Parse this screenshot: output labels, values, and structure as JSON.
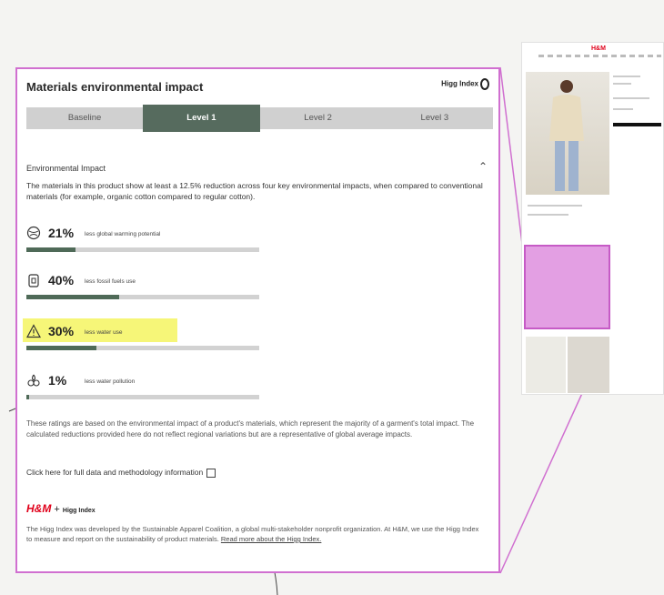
{
  "panel": {
    "title": "Materials environmental impact",
    "higg_logo_text": "Higg Index",
    "tabs": [
      {
        "label": "Baseline",
        "active": false
      },
      {
        "label": "Level 1",
        "active": true
      },
      {
        "label": "Level 2",
        "active": false
      },
      {
        "label": "Level 3",
        "active": false
      }
    ],
    "section_title": "Environmental Impact",
    "description": "The materials in this product show at least a 12.5% reduction across four key environmental impacts, when compared to conventional materials (for example, organic cotton compared to regular cotton).",
    "metrics": [
      {
        "icon": "globe-warming-icon",
        "value": "21%",
        "label": "less global warming potential",
        "level": 0.21,
        "highlighted": false
      },
      {
        "icon": "fossil-fuel-icon",
        "value": "40%",
        "label": "less fossil fuels use",
        "level": 0.4,
        "highlighted": false
      },
      {
        "icon": "water-warning-icon",
        "value": "30%",
        "label": "less water use",
        "level": 0.3,
        "highlighted": true
      },
      {
        "icon": "water-pollution-icon",
        "value": "1%",
        "label": "less water pollution",
        "level": 0.01,
        "highlighted": false
      }
    ],
    "footnote": "These ratings are based on the environmental impact of a product's materials, which represent the majority of a garment's total impact. The calculated reductions provided here do not reflect regional variations but are a representative of global average impacts.",
    "methodology_link": "Click here for full data and methodology information",
    "brand_plus": "+",
    "higg_note": "The Higg Index was developed by the Sustainable Apparel Coalition, a global multi-stakeholder nonprofit organization. At H&M, we use the Higg Index to measure and report on the sustainability of product materials.",
    "higg_note_link": "Read more about the Higg Index."
  },
  "mini_page": {
    "brand": "H&M"
  },
  "colors": {
    "callout": "#d06fd0",
    "active_tab": "#566b5e",
    "bar_fill": "#4f6a58",
    "highlight": "#f5f560",
    "brand_red": "#e0001a"
  }
}
